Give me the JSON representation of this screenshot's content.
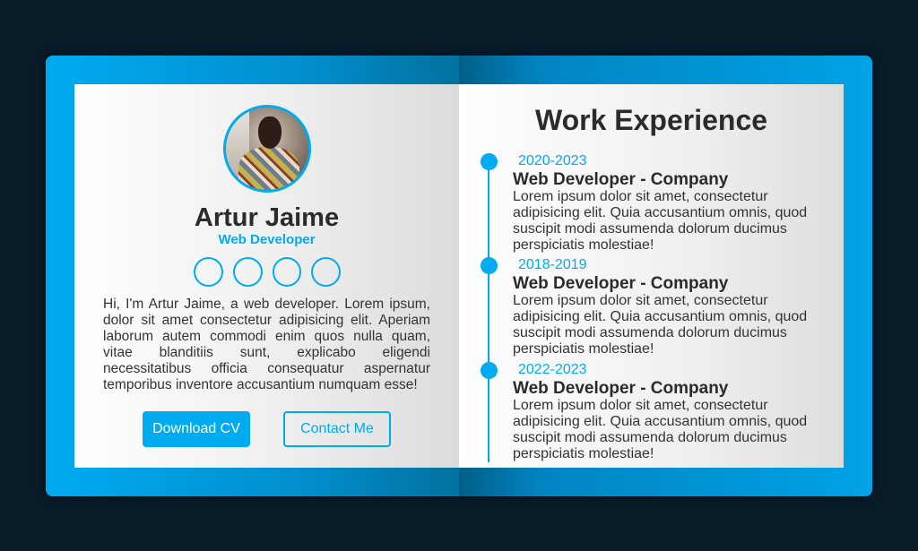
{
  "profile": {
    "name": "Artur Jaime",
    "role": "Web Developer",
    "bio": "Hi, I'm Artur Jaime, a web developer. Lorem ipsum, dolor sit amet consectetur adipisicing elit. Aperiam laborum autem commodi enim quos nulla quam, vitae blanditiis sunt, explicabo eligendi necessitatibus officia consequatur aspernatur temporibus inventore accusantium numquam esse!",
    "download_label": "Download CV",
    "contact_label": "Contact Me",
    "socials": [
      "social-icon",
      "social-icon",
      "social-icon",
      "social-icon"
    ]
  },
  "experience": {
    "title": "Work Experience",
    "items": [
      {
        "year": "2020-2023",
        "title": "Web Developer - Company",
        "desc": "Lorem ipsum dolor sit amet, consectetur adipisicing elit. Quia accusantium omnis, quod suscipit modi assumenda dolorum ducimus perspiciatis molestiae!"
      },
      {
        "year": "2018-2019",
        "title": "Web Developer - Company",
        "desc": "Lorem ipsum dolor sit amet, consectetur adipisicing elit. Quia accusantium omnis, quod suscipit modi assumenda dolorum ducimus perspiciatis molestiae!"
      },
      {
        "year": "2022-2023",
        "title": "Web Developer - Company",
        "desc": "Lorem ipsum dolor sit amet, consectetur adipisicing elit. Quia accusantium omnis, quod suscipit modi assumenda dolorum ducimus perspiciatis molestiae!"
      }
    ]
  },
  "colors": {
    "accent": "#00abf0",
    "background": "#081b29",
    "text": "#2b2b2b"
  }
}
